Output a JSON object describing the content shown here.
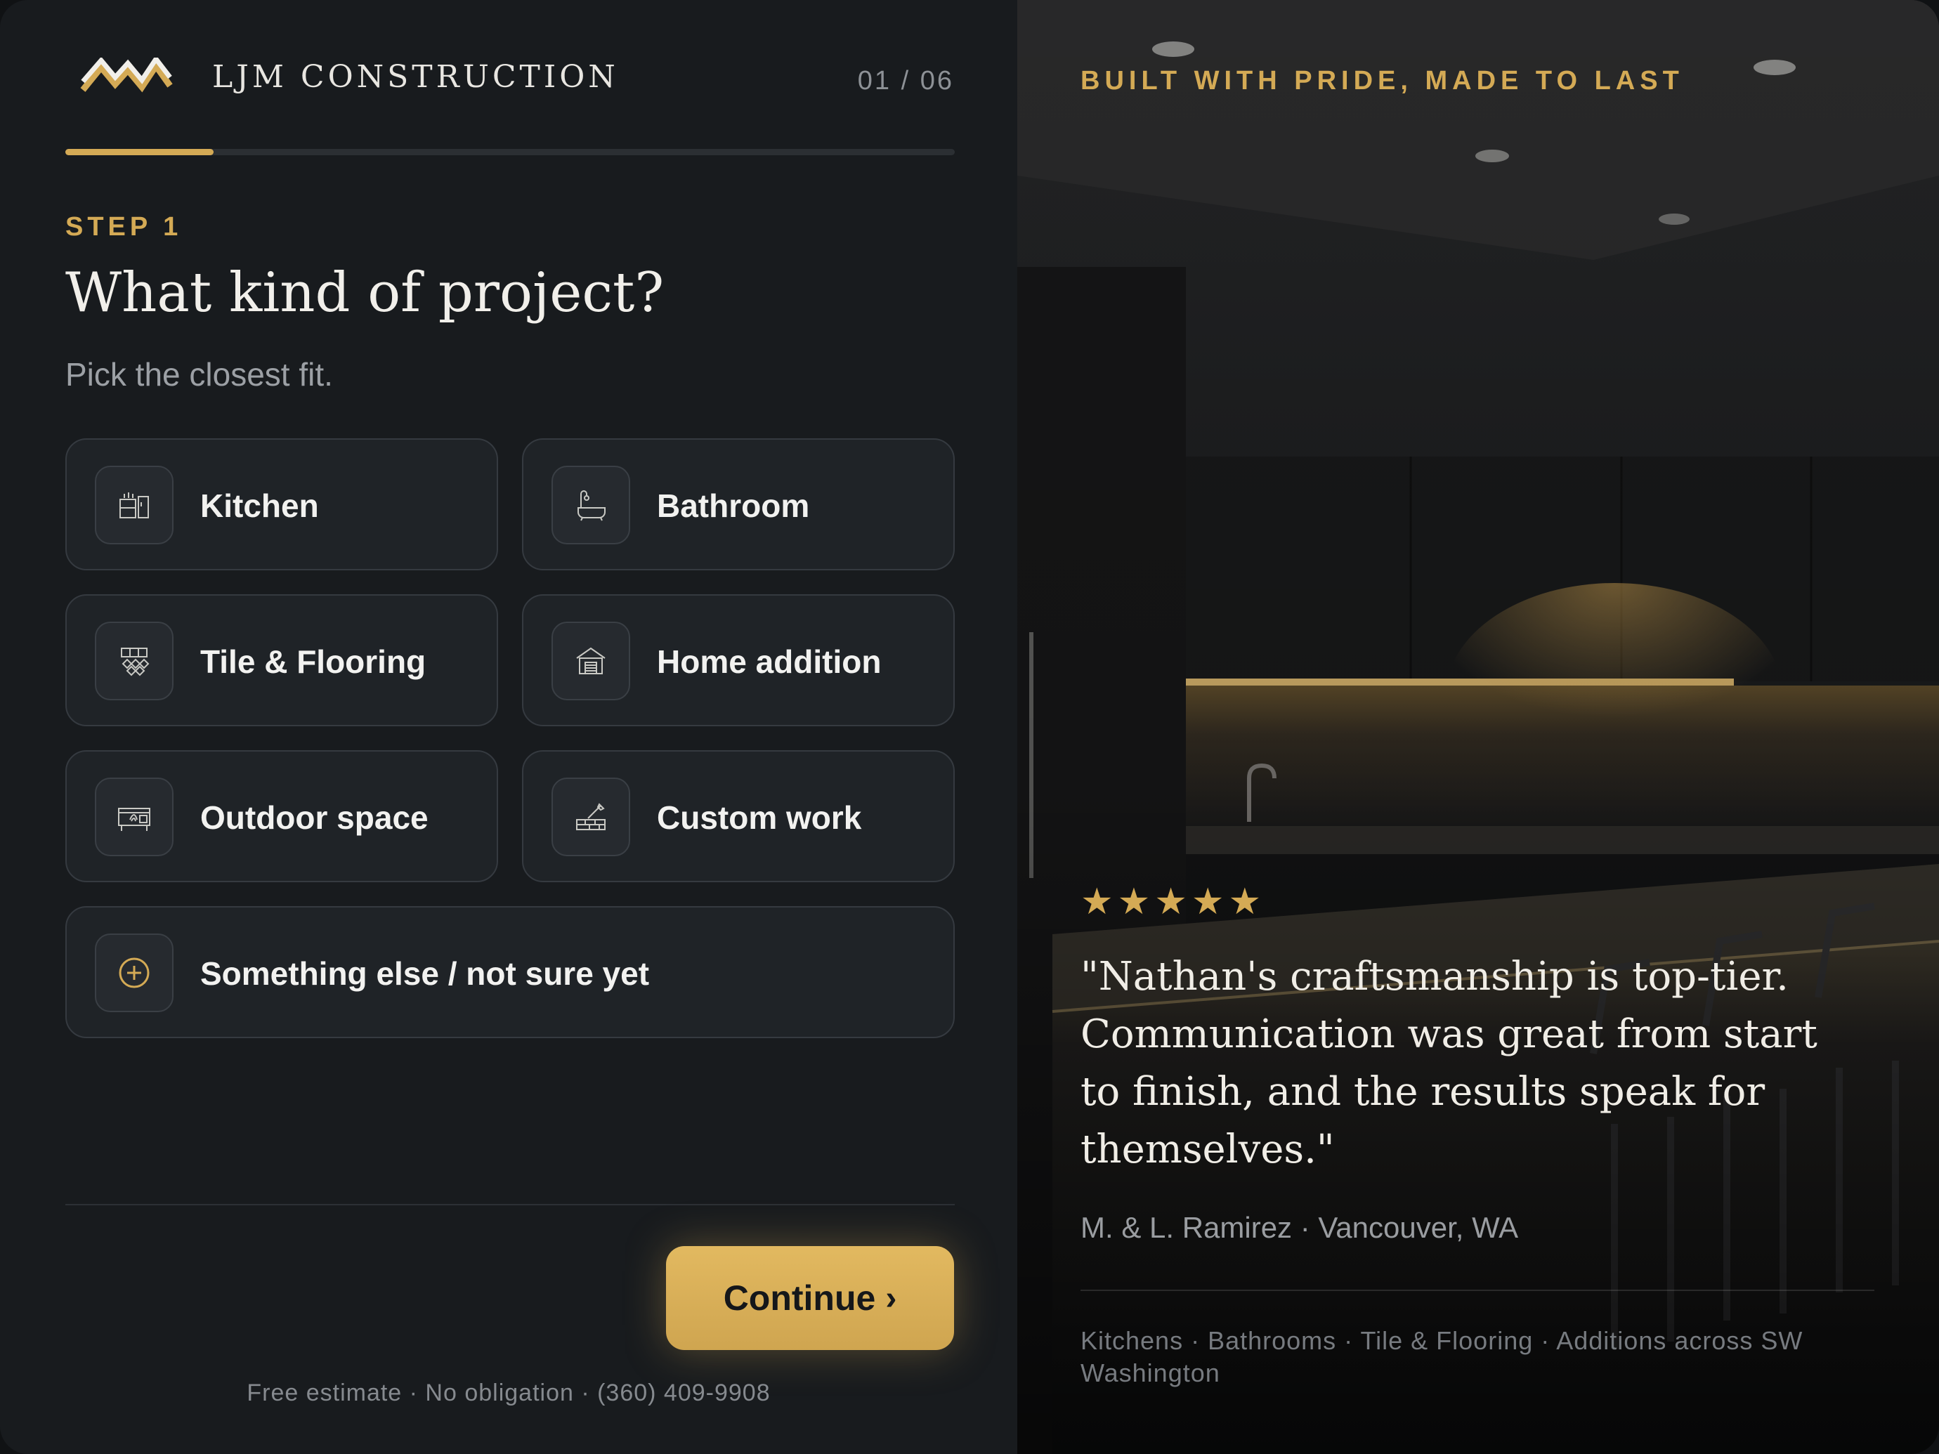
{
  "brand": {
    "name": "LJM CONSTRUCTION",
    "logo_icon": "mountain-logo-icon"
  },
  "progress": {
    "label": "01 / 06",
    "fraction": 0.1667
  },
  "step": {
    "eyebrow": "STEP 1",
    "title": "What kind of project?",
    "subtitle": "Pick the closest fit."
  },
  "options": [
    {
      "label": "Kitchen",
      "icon": "kitchen-icon"
    },
    {
      "label": "Bathroom",
      "icon": "bathtub-icon"
    },
    {
      "label": "Tile & Flooring",
      "icon": "tile-icon"
    },
    {
      "label": "Home addition",
      "icon": "house-addition-icon"
    },
    {
      "label": "Outdoor space",
      "icon": "outdoor-grill-icon"
    },
    {
      "label": "Custom work",
      "icon": "custom-work-icon"
    },
    {
      "label": "Something else / not sure yet",
      "icon": "plus-circle-icon"
    }
  ],
  "actions": {
    "continue_label": "Continue",
    "continue_chevron": "›"
  },
  "footnote": "Free estimate · No obligation · (360) 409-9908",
  "testimonial": {
    "tagline": "BUILT WITH PRIDE, MADE TO LAST",
    "rating": 5,
    "quote": "\"Nathan's craftsmanship is top-tier. Communication was great from start to finish, and the results speak for themselves.\"",
    "author": "M. & L. Ramirez · Vancouver, WA",
    "services": "Kitchens · Bathrooms · Tile & Flooring · Additions across SW Washington"
  },
  "colors": {
    "accent": "#d4aa55",
    "panel_bg": "#181b1e",
    "card_bg": "#1f2327",
    "text_primary": "#f2f2f0",
    "text_muted": "#9ca0a5"
  }
}
